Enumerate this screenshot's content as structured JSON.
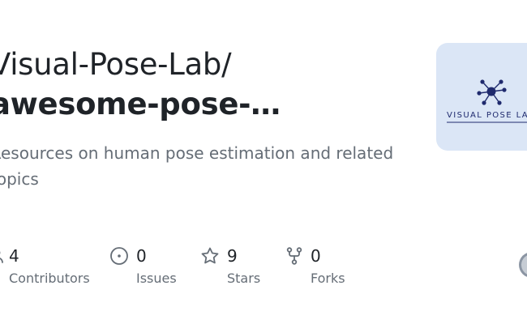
{
  "repo": {
    "owner_line": "Visual-Pose-Lab/",
    "name_line": "awesome-pose-…",
    "description": "Resources on human pose estimation and related topics",
    "thumbnail_text": "VISUAL POSE LAB"
  },
  "stats": {
    "contributors": {
      "value": "4",
      "label": "Contributors"
    },
    "issues": {
      "value": "0",
      "label": "Issues"
    },
    "stars": {
      "value": "9",
      "label": "Stars"
    },
    "forks": {
      "value": "0",
      "label": "Forks"
    }
  },
  "icons": {
    "contributors": "people-icon",
    "issues": "issue-opened-icon",
    "stars": "star-icon",
    "forks": "repo-forked-icon"
  },
  "colors": {
    "text": "#1f2328",
    "muted": "#656d76",
    "thumbnail_bg": "#dbe6f6",
    "logo": "#1f2a6e"
  }
}
